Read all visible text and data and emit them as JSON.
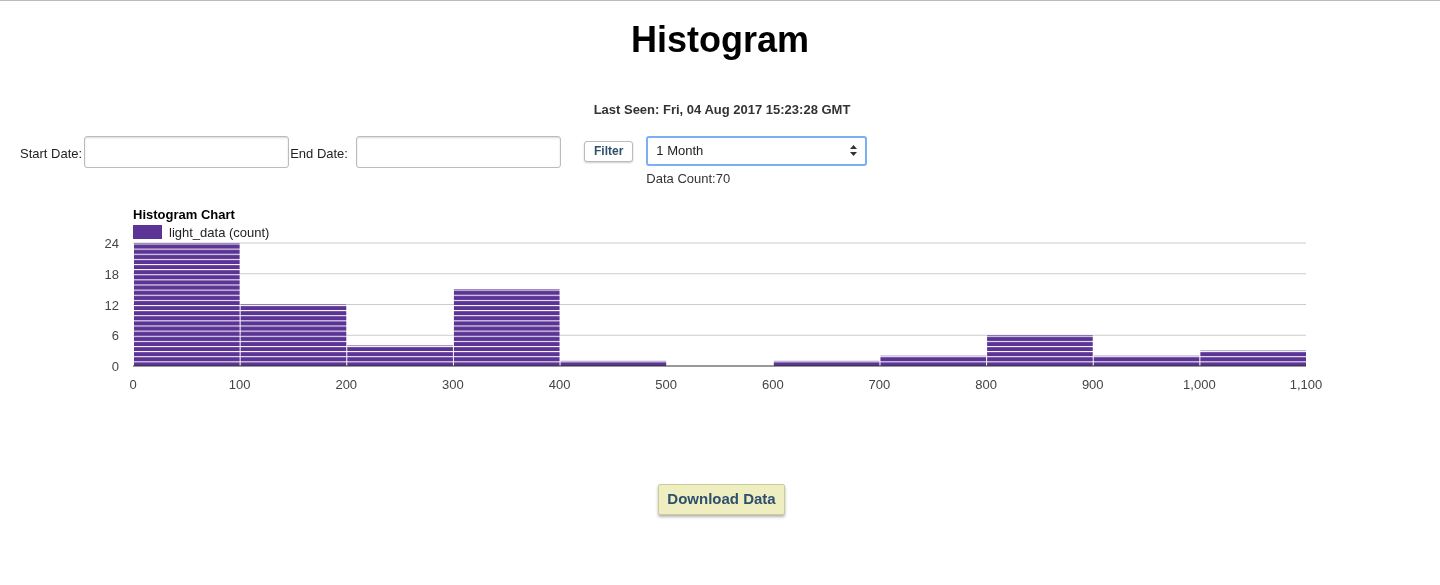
{
  "title": "Histogram",
  "last_seen": "Last Seen: Fri, 04 Aug 2017 15:23:28 GMT",
  "filters": {
    "start_date": {
      "label": "Start Date:"
    },
    "end_date": {
      "label": "End Date:"
    },
    "filter_button": "Filter",
    "range_select": {
      "value": "1 Month"
    },
    "data_count": "Data Count:70"
  },
  "chart": {
    "chart_data": {
      "type": "bar",
      "title": "Histogram Chart",
      "x": [
        50,
        150,
        250,
        350,
        450,
        550,
        650,
        750,
        850,
        950,
        1050
      ],
      "series": [
        {
          "name": "light_data (count)",
          "color": "#5b3495",
          "values": [
            24,
            12,
            4,
            15,
            1,
            0,
            1,
            2,
            6,
            2,
            3
          ]
        }
      ],
      "xlim": [
        0,
        1100
      ],
      "ylim": [
        0,
        24
      ],
      "xticks": [
        0,
        100,
        200,
        300,
        400,
        500,
        600,
        700,
        800,
        900,
        {
          "value": 1000,
          "label": "1,000"
        },
        {
          "value": 1100,
          "label": "1,100"
        }
      ],
      "yticks": [
        0,
        6,
        12,
        18,
        24
      ],
      "grid": true
    }
  },
  "download_button": "Download Data"
}
